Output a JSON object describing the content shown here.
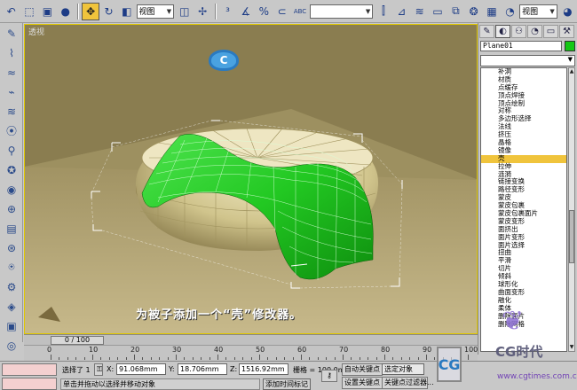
{
  "toolbar": {
    "view_select": "视图",
    "dropdown_blank": "",
    "icons": [
      "undo-icon",
      "select-region-icon",
      "select-object-icon",
      "select-by-name-icon",
      "move-icon",
      "rotate-icon",
      "scale-icon",
      "view-dropdown",
      "pivot-icon",
      "select-manipulate-icon",
      "snap-icon",
      "angle-snap-icon",
      "percent-snap-icon",
      "spinner-snap-icon",
      "abc-edit-icon",
      "named-selection-dropdown",
      "mirror-icon",
      "align-icon",
      "layer-icon",
      "curve-editor-icon",
      "schematic-icon",
      "material-editor-icon",
      "render-scene-icon",
      "quick-render-icon",
      "render-type-dropdown",
      "render-last-icon"
    ],
    "abc_label": "ABC"
  },
  "viewport": {
    "label": "透视",
    "caption": "为被子添加一个“壳”修改器。",
    "badge": "C"
  },
  "panel": {
    "tabs": [
      "create-tab",
      "modify-tab",
      "hierarchy-tab",
      "motion-tab",
      "display-tab",
      "utilities-tab"
    ],
    "object_name": "Plane01",
    "object_color": "#14c814",
    "modifier_dropdown_value": "",
    "modifiers": [
      "补洞",
      "材质",
      "点缓存",
      "顶点焊接",
      "顶点绘制",
      "对称",
      "多边形选择",
      "法线",
      "挤压",
      "晶格",
      "镜像",
      "壳",
      "拉伸",
      "涟漪",
      "链接变换",
      "路径变形",
      "蒙皮",
      "蒙皮包裹",
      "蒙皮包裹面片",
      "蒙皮变形",
      "面挤出",
      "面片变形",
      "面片选择",
      "扭曲",
      "平滑",
      "切片",
      "倾斜",
      "球形化",
      "曲面变形",
      "融化",
      "柔体",
      "删除面片",
      "删除网格"
    ],
    "selected_modifier": "壳"
  },
  "timeline": {
    "slider_label": "0 / 100",
    "ticks": [
      "0",
      "10",
      "20",
      "30",
      "40",
      "50",
      "60",
      "70",
      "80",
      "90",
      "100"
    ]
  },
  "status": {
    "selected": "选择了 1",
    "x_label": "X:",
    "x_value": "91.068mm",
    "y_label": "Y:",
    "y_value": "18.706mm",
    "z_label": "Z:",
    "z_value": "1516.92mm",
    "grid": "栅格 = 100.0mm",
    "auto_key": "自动关键点",
    "set_key": "设置关键点",
    "selected_object": "选定对象",
    "key_filter": "关键点过滤器...",
    "prompt": "单击并拖动以选择并移动对象",
    "add_time_tag": "添加时间标记"
  },
  "watermark": {
    "brand": "CG时代",
    "url": "www.cgtimes.com.cn",
    "logo": "CG"
  }
}
